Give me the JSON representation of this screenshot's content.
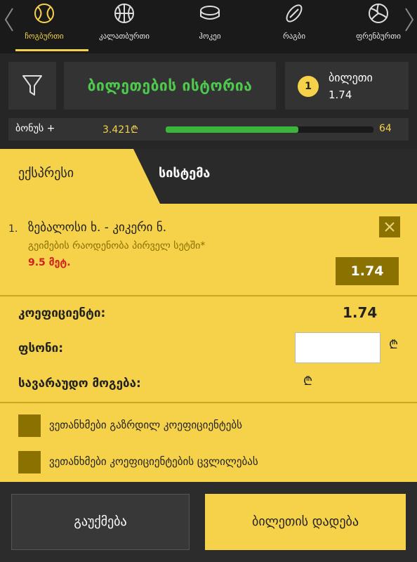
{
  "sports_nav": {
    "items": [
      {
        "label": "ჩოგბურთი",
        "icon": "tennis-ball-icon",
        "active": true
      },
      {
        "label": "კალათბურთი",
        "icon": "basketball-icon",
        "active": false
      },
      {
        "label": "ჰოკეი",
        "icon": "hockey-puck-icon",
        "active": false
      },
      {
        "label": "რაგბი",
        "icon": "rugby-ball-icon",
        "active": false
      },
      {
        "label": "ფრენბურთი",
        "icon": "volleyball-icon",
        "active": false
      }
    ]
  },
  "header": {
    "history_label": "ბილეთების ისტორია",
    "ticket_count": "1",
    "ticket_label": "ბილეთი",
    "ticket_odd": "1.74"
  },
  "bonus": {
    "label": "ბონუს +",
    "amount": "3.421₾",
    "progress": 0.64,
    "count": "64"
  },
  "tabs": {
    "express": "ექსპრესი",
    "system": "სისტემა"
  },
  "bet": {
    "number": "1.",
    "match": "ზებალოსი ხ. - კიკერი ნ.",
    "market": "გეიმების რაოდენობა პირველ სეტში*",
    "selection": "9.5 მეტ.",
    "odd": "1.74"
  },
  "summary": {
    "coef_label": "კოეფიციენტი:",
    "coef_value": "1.74",
    "stake_label": "ფსონი:",
    "stake_value": "",
    "currency": "₾",
    "win_label": "სავარაუდო მოგება:"
  },
  "options": [
    {
      "label": "ვეთანხმები გაზრდილ კოეფიციენტებს"
    },
    {
      "label": "ვეთანხმები კოეფიციენტების ცვლილებას"
    }
  ],
  "footer": {
    "clear": "გაუქმება",
    "place": "ბილეთის დადება"
  },
  "colors": {
    "accent": "#f5d24a",
    "green": "#4ec94e",
    "red": "#d02020"
  }
}
